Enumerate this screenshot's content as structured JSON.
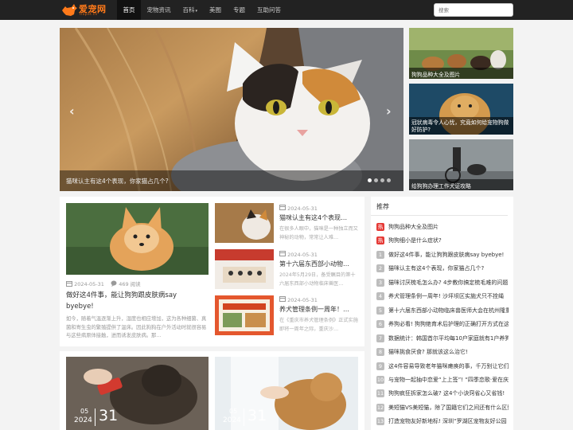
{
  "logo": {
    "name": "爱宠网",
    "sub": "tiopet.cn"
  },
  "nav": {
    "items": [
      {
        "label": "首页",
        "active": true
      },
      {
        "label": "宠物资讯"
      },
      {
        "label": "百科",
        "caret": "▾"
      },
      {
        "label": "美图"
      },
      {
        "label": "专题"
      },
      {
        "label": "互助问答"
      }
    ]
  },
  "search": {
    "placeholder": "搜索"
  },
  "hero": {
    "caption": "猫咪认主有这4个表现，你家猫占几个?",
    "prev_glyph": "‹",
    "next_glyph": "›",
    "slide_count": 4,
    "active_slide": 0
  },
  "side_thumbs": [
    {
      "caption": "狗狗品种大全及图片"
    },
    {
      "caption": "冠状病毒令人心忧，究竟如何给宠物狗做好防护?"
    },
    {
      "caption": "给狗狗办理工作犬证攻略"
    }
  ],
  "main_article": {
    "date": "2024-05-31",
    "views": "469 阅读",
    "title": "做好这4件事，能让狗狗跟皮肤病say byebye!",
    "desc": "如今，随着气温逐渐上升，湿度也相应增加，这为各种细菌、真菌和寄生虫的繁殖提供了温床。因此狗狗在户外活动时就很容易与这些病原体接触，进而诱发皮肤病。那…"
  },
  "small_articles": [
    {
      "date": "2024-05-31",
      "title": "猫咪认主有这4个表现…",
      "desc": "在很多人眼中，猫咪是一种独立而又神秘的动物，常常让人难…"
    },
    {
      "date": "2024-05-31",
      "title": "第十六届东西部小动物…",
      "desc": "2024年5月29日，备受瞩目的第十六届东西部小动物临床兽医…"
    },
    {
      "date": "2024-05-31",
      "title": "养犬管理条例一周年！…",
      "desc": "在《重庆市养犬管理条例》正式实施即将一周年之际，重庆沙…"
    }
  ],
  "bottom_cards": [
    {
      "month": "05",
      "year": "2024",
      "day": "31"
    },
    {
      "month": "05",
      "year": "2024",
      "day": "31"
    }
  ],
  "recommend": {
    "heading": "推荐",
    "items": [
      {
        "num": "热",
        "hot": true,
        "text": "狗狗品种大全及图片"
      },
      {
        "num": "热",
        "hot": true,
        "text": "狗狗细小是什么症状?"
      },
      {
        "num": "1",
        "text": "做好这4件事，能让狗狗跟皮肤病say byebye!"
      },
      {
        "num": "2",
        "text": "猫咪认主有这4个表现，你家猫占几个?"
      },
      {
        "num": "3",
        "text": "猫咪讨厌梳毛怎么办? 4步教你搞定梳毛难的问题"
      },
      {
        "num": "4",
        "text": "养犬管理条例一周年! 沙坪坝区实施犬只不拴绳"
      },
      {
        "num": "5",
        "text": "第十六届东西部小动物临床兽医师大会在杭州隆重"
      },
      {
        "num": "6",
        "text": "养狗必看! 狗狗绝育术后护理的正确打开方式在这"
      },
      {
        "num": "7",
        "text": "数据统计：韩国首尔平均每10户家庭就有1户养狗"
      },
      {
        "num": "8",
        "text": "猫咪挑食厌食? 那就该这么治它!"
      },
      {
        "num": "9",
        "text": "这4件容易导致老年猫咪瘫痪的事，千万别让它们做"
      },
      {
        "num": "10",
        "text": "与宠物一起抽中恋爱“上上签”! “四季恋歌·爱在庆"
      },
      {
        "num": "11",
        "text": "狗狗疯狂拆家怎么破? 这4个小诀窍省心又省钱!"
      },
      {
        "num": "12",
        "text": "美短猫VS美短猫，除了国籍它们之间还有什么区别"
      },
      {
        "num": "13",
        "text": "打造宠物友好新地标! 深圳“罗湖区宠物友好公园"
      }
    ]
  },
  "colors": {
    "nav_bg": "#222222",
    "accent": "#ff7a1a",
    "hot": "#e53935"
  }
}
